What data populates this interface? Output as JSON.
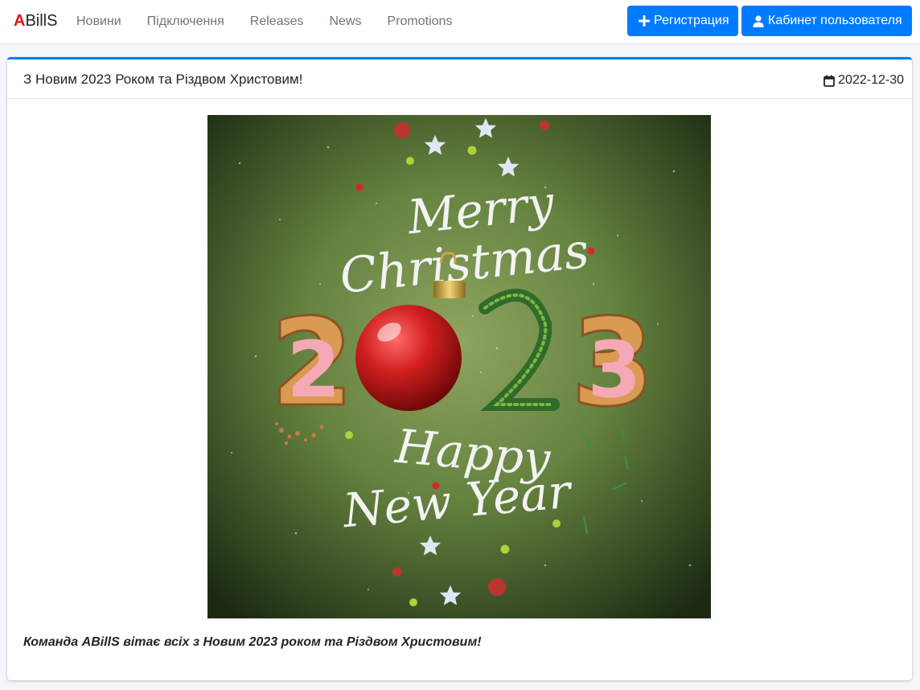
{
  "navbar": {
    "brand_accent": "A",
    "brand_rest": "BillS",
    "links": [
      "Новини",
      "Підключення",
      "Releases",
      "News",
      "Promotions"
    ],
    "register_label": "Регистрация",
    "cabinet_label": "Кабинет пользователя"
  },
  "post": {
    "title": "З Новим 2023 Роком та Різдвом Христовим!",
    "date": "2022-12-30",
    "image": {
      "greeting_line1": "Merry",
      "greeting_line2": "Christmas",
      "year_digits": [
        "2",
        "0",
        "2",
        "3"
      ],
      "greeting_line3": "Happy",
      "greeting_line4": "New Year"
    },
    "text": "Команда ABillS вітає всіх з Новим 2023 роком та Різдвом Христовим!"
  },
  "colors": {
    "brand_red": "#e01515",
    "primary": "#007bff",
    "card_accent": "#007bff",
    "image_bg": "#5e7a3a",
    "ornament_red": "#d21f1f",
    "cookie": "#d99a52",
    "icing_pink": "#f5a8b5"
  },
  "icons": {
    "register": "plus-icon",
    "cabinet": "user-icon",
    "date": "calendar-icon"
  }
}
